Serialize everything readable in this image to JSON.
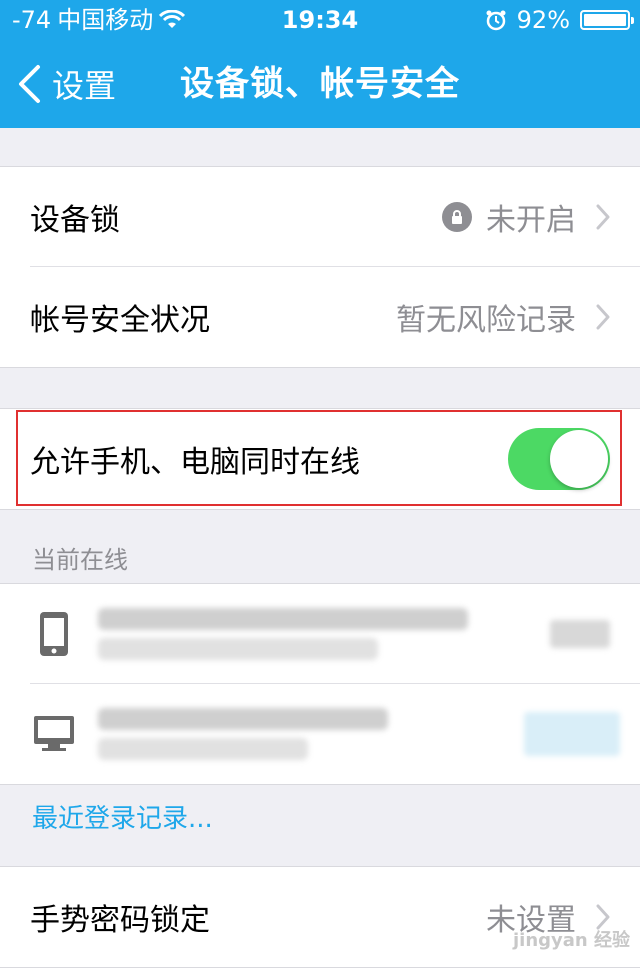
{
  "status_bar": {
    "signal": "-74",
    "carrier": "中国移动",
    "time": "19:34",
    "battery": "92%"
  },
  "nav": {
    "back_label": "设置",
    "title": "设备锁、帐号安全"
  },
  "security": {
    "device_lock": {
      "label": "设备锁",
      "value": "未开启"
    },
    "account_status": {
      "label": "帐号安全状况",
      "value": "暂无风险记录"
    }
  },
  "online": {
    "allow_label": "允许手机、电脑同时在线",
    "allow_enabled": true
  },
  "current_online": {
    "header": "当前在线"
  },
  "recent_login_link": "最近登录记录...",
  "gesture": {
    "label": "手势密码锁定",
    "value": "未设置"
  },
  "watermark": "jingyan 经验",
  "colors": {
    "header_bg": "#1ea7ea",
    "toggle_on": "#4cd964",
    "link": "#1ea7ea",
    "highlight_border": "#e03030"
  },
  "icons": [
    "wifi-icon",
    "alarm-icon",
    "battery-icon",
    "chevron-left-icon",
    "lock-icon",
    "chevron-right-icon",
    "phone-icon",
    "monitor-icon"
  ]
}
